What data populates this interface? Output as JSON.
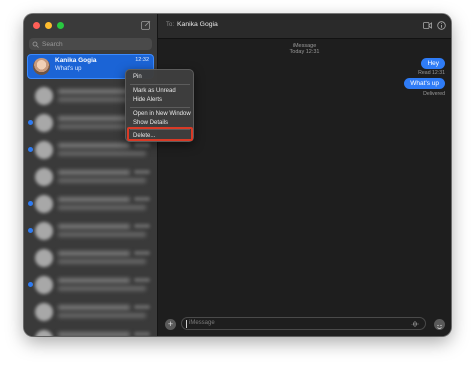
{
  "sidebar": {
    "search_placeholder": "Search",
    "selected_conversation": {
      "name": "Kanika Gogia",
      "preview": "What's up",
      "time": "12:32"
    },
    "blurred_conversations": [
      {
        "unread": false
      },
      {
        "unread": true
      },
      {
        "unread": true
      },
      {
        "unread": false
      },
      {
        "unread": true
      },
      {
        "unread": true
      },
      {
        "unread": false
      },
      {
        "unread": true
      },
      {
        "unread": false
      },
      {
        "unread": false
      }
    ]
  },
  "context_menu": {
    "items": [
      "Pin",
      "Mark as Unread",
      "Hide Alerts",
      "Open in New Window",
      "Show Details",
      "Delete..."
    ]
  },
  "chat": {
    "to_label": "To:",
    "contact_name": "Kanika Gogia",
    "service": "iMessage",
    "service_time": "Today 12:31",
    "messages": [
      "Hey",
      "What's up"
    ],
    "read_receipt": "Read 12:31",
    "delivered": "Delivered",
    "input_placeholder": "iMessage"
  },
  "colors": {
    "accent": "#2f7cf6",
    "highlight_border": "#d93a26"
  }
}
